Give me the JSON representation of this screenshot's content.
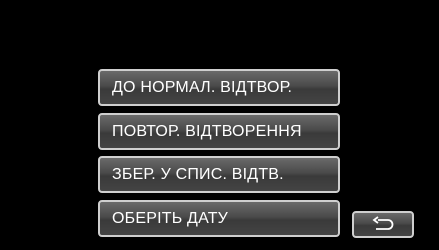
{
  "menu": {
    "items": [
      {
        "label": "ДО НОРМАЛ. ВІДТВОР."
      },
      {
        "label": "ПОВТОР. ВІДТВОРЕННЯ"
      },
      {
        "label": "ЗБЕР. У СПИС. ВІДТВ."
      },
      {
        "label": "ОБЕРІТЬ ДАТУ"
      }
    ]
  },
  "back_button": {
    "icon": "return-arrow-icon"
  },
  "colors": {
    "background": "#000000",
    "button_fill": "#4a4a4a",
    "button_border": "#cfcfcf",
    "text": "#ffffff"
  }
}
